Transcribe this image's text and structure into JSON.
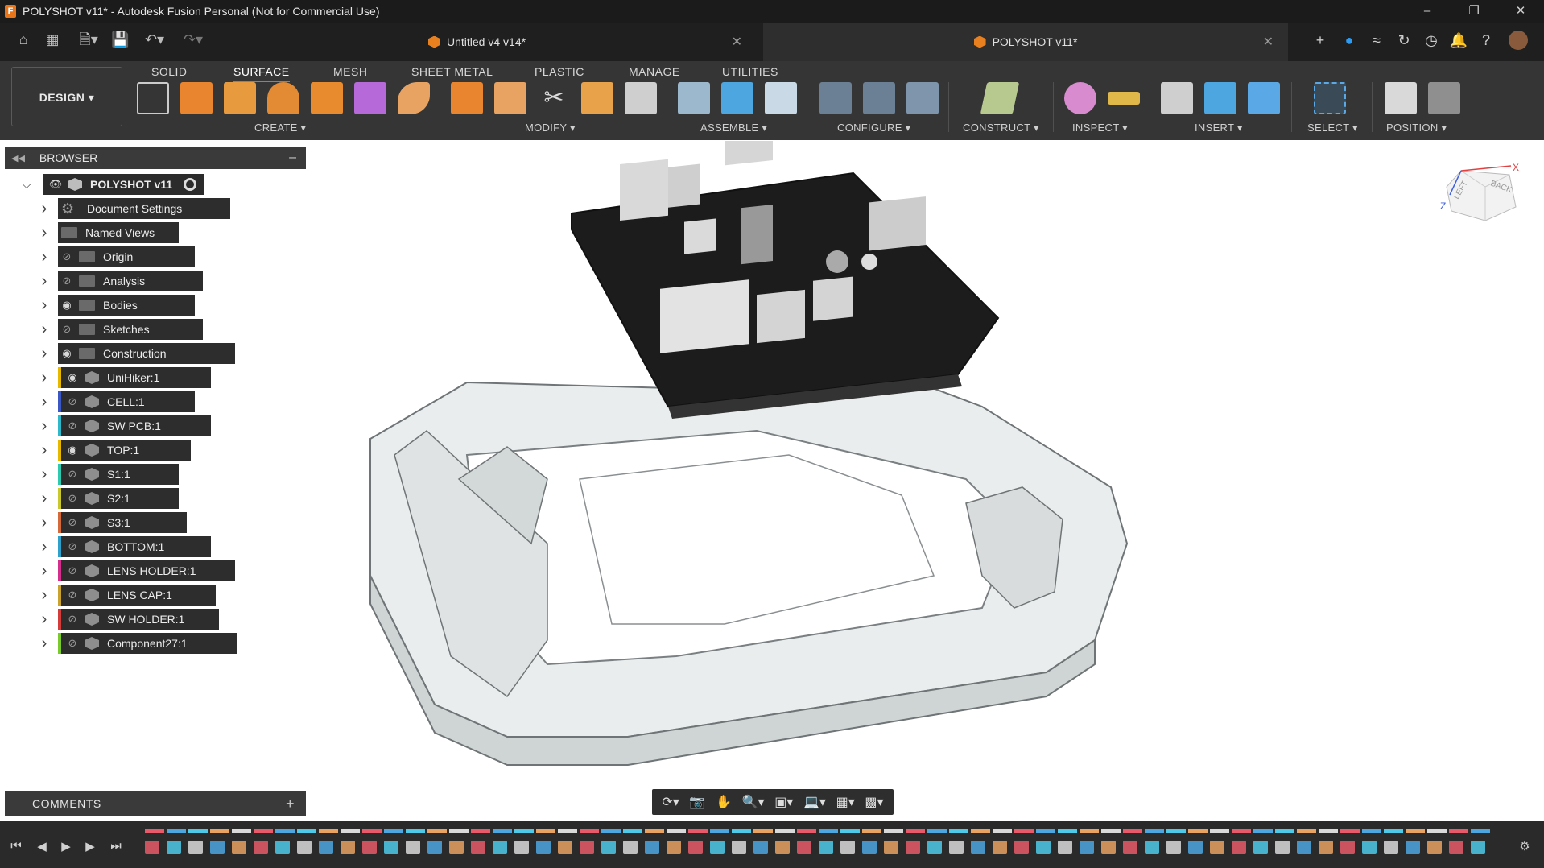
{
  "window": {
    "title": "POLYSHOT v11* - Autodesk Fusion Personal (Not for Commercial Use)",
    "app_icon": "F"
  },
  "tabs": [
    {
      "label": "Untitled v4 v14*"
    },
    {
      "label": "POLYSHOT v11*"
    }
  ],
  "workspace": {
    "label": "DESIGN"
  },
  "workspace_tabs": [
    "SOLID",
    "SURFACE",
    "MESH",
    "SHEET METAL",
    "PLASTIC",
    "MANAGE",
    "UTILITIES"
  ],
  "tool_groups": {
    "create": "CREATE",
    "modify": "MODIFY",
    "assemble": "ASSEMBLE",
    "configure": "CONFIGURE",
    "construct": "CONSTRUCT",
    "inspect": "INSPECT",
    "insert": "INSERT",
    "select": "SELECT",
    "position": "POSITION"
  },
  "browser": {
    "title": "BROWSER",
    "root": "POLYSHOT v11",
    "items": [
      {
        "label": "Document Settings",
        "kind": "gear-icon",
        "eye": "none"
      },
      {
        "label": "Named Views",
        "kind": "folder-icon",
        "eye": "none"
      },
      {
        "label": "Origin",
        "kind": "folder-icon",
        "eye": "hidden"
      },
      {
        "label": "Analysis",
        "kind": "folder-icon",
        "eye": "hidden"
      },
      {
        "label": "Bodies",
        "kind": "folder-icon",
        "eye": "visible"
      },
      {
        "label": "Sketches",
        "kind": "folder-icon",
        "eye": "hidden"
      },
      {
        "label": "Construction",
        "kind": "folder-icon",
        "eye": "visible"
      },
      {
        "label": "UniHiker:1",
        "kind": "component-icon",
        "eye": "visible",
        "color": "#e6b800"
      },
      {
        "label": "CELL:1",
        "kind": "component-icon",
        "eye": "hidden",
        "color": "#3b57c4"
      },
      {
        "label": "SW PCB:1",
        "kind": "component-icon",
        "eye": "hidden",
        "color": "#2fb8c9"
      },
      {
        "label": "TOP:1",
        "kind": "component-icon",
        "eye": "visible",
        "color": "#e6b800"
      },
      {
        "label": "S1:1",
        "kind": "component-icon",
        "eye": "hidden",
        "color": "#2fc9b0"
      },
      {
        "label": "S2:1",
        "kind": "component-icon",
        "eye": "hidden",
        "color": "#c9c92f"
      },
      {
        "label": "S3:1",
        "kind": "component-icon",
        "eye": "hidden",
        "color": "#d46a3b"
      },
      {
        "label": "BOTTOM:1",
        "kind": "component-icon",
        "eye": "hidden",
        "color": "#2fa0c9"
      },
      {
        "label": "LENS HOLDER:1",
        "kind": "component-icon",
        "eye": "hidden",
        "color": "#d42f8c"
      },
      {
        "label": "LENS CAP:1",
        "kind": "component-icon",
        "eye": "hidden",
        "color": "#c9a22f"
      },
      {
        "label": "SW HOLDER:1",
        "kind": "component-icon",
        "eye": "hidden",
        "color": "#d43b3b"
      },
      {
        "label": "Component27:1",
        "kind": "component-icon",
        "eye": "hidden",
        "color": "#7ac92f"
      }
    ]
  },
  "comments": {
    "title": "COMMENTS"
  },
  "viewcube": {
    "face_back": "BACK",
    "face_left": "LEFT",
    "axis_x": "X",
    "axis_z": "Z"
  },
  "colors": {
    "accent": "#2b9bf4",
    "brand": "#e8751a"
  }
}
